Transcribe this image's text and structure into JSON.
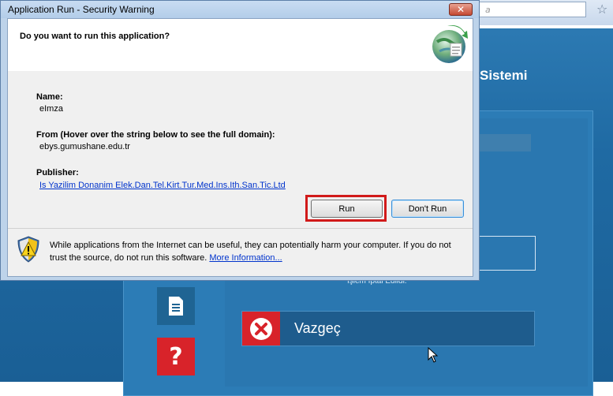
{
  "browser": {
    "address_text": "a"
  },
  "background": {
    "site_title": "Sistemi",
    "cancel_message": "İşlem İptal Edildi.",
    "cancel_button_label": "Vazgeç",
    "help_label": "?"
  },
  "dialog": {
    "title": "Application Run - Security Warning",
    "close_label": "✕",
    "question": "Do you want to run this application?",
    "name_label": "Name:",
    "name_value": "eImza",
    "from_label": "From (Hover over the string below to see the full domain):",
    "from_value": "ebys.gumushane.edu.tr",
    "publisher_label": "Publisher:",
    "publisher_value": "Is Yazilim Donanim Elek.Dan.Tel.Kirt.Tur.Med.Ins.Ith.San.Tic.Ltd",
    "run_label": "Run",
    "dont_run_label": "Don't Run",
    "warning_text": "While applications from the Internet can be useful, they can potentially harm your computer. If you do not trust the source, do not run this software.",
    "more_info_label": "More Information..."
  },
  "colors": {
    "highlight": "#d11a1a",
    "link": "#0033cc",
    "page_blue": "#2a77b0",
    "cancel_red": "#d8232a"
  }
}
